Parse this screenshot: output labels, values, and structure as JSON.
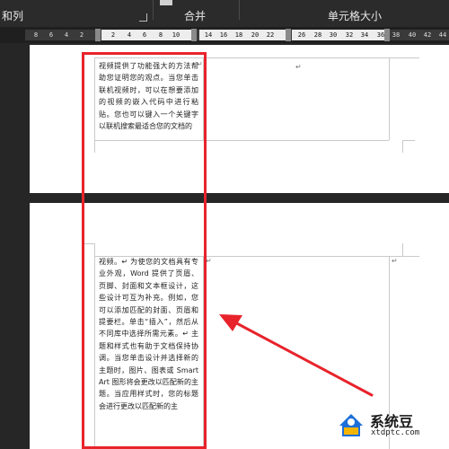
{
  "ribbon": {
    "left_label": "和列",
    "merge_label": "合并",
    "cell_size_label": "单元格大小"
  },
  "ruler": {
    "ticks": [
      "8",
      "6",
      "4",
      "2",
      "2",
      "4",
      "6",
      "8",
      "10",
      "14",
      "16",
      "18",
      "20",
      "22",
      "26",
      "28",
      "30",
      "32",
      "34",
      "36",
      "38",
      "40",
      "42",
      "44"
    ]
  },
  "page1": {
    "cell_text": "视频提供了功能强大的方法帮助您证明您的观点。当您单击联机视频时，可以在想要添加的视频的嵌入代码中进行粘贴。您也可以键入一个关键字以联机搜索最适合您的文档的",
    "mark1": "↵",
    "mark2": "↵"
  },
  "page2": {
    "cell_text": "视频。↵ 为使您的文档具有专业外观，Word 提供了页眉、页脚、封面和文本框设计，这些设计可互为补充。例如，您可以添加匹配的封面、页眉和提要栏。单击“插入”，然后从不同库中选择所需元素。↵ 主题和样式也有助于文档保持协调。当您单击设计并选择新的主题时，图片、图表或 SmartArt 图形将会更改以匹配新的主题。当应用样式时，您的标题会进行更改以匹配新的主",
    "mark1": "↵",
    "mark2": "↵"
  },
  "watermark": {
    "title": "系统豆",
    "url": "xtdptc.com"
  },
  "colors": {
    "annotation": "#e8232b",
    "page": "#ffffff",
    "background": "#262626"
  }
}
